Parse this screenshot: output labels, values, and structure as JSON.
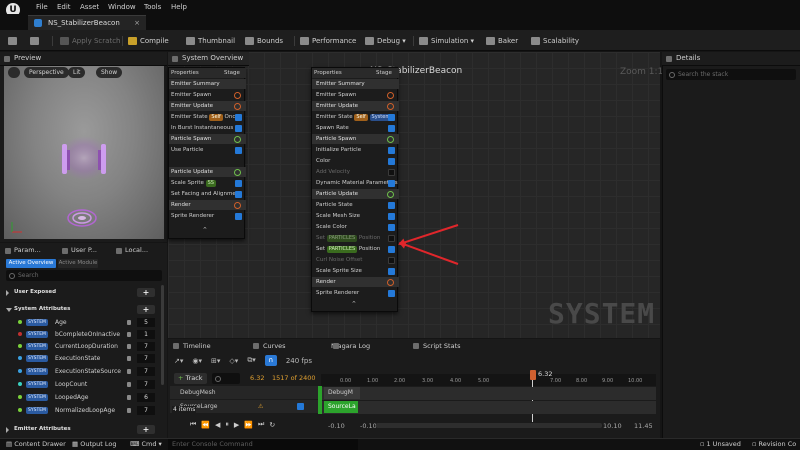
{
  "menu": {
    "items": [
      "File",
      "Edit",
      "Asset",
      "Window",
      "Tools",
      "Help"
    ]
  },
  "document_tab": {
    "label": "NS_StabilizerBeacon"
  },
  "toolbar": {
    "apply_scratch": "Apply Scratch",
    "compile": "Compile",
    "thumbnail": "Thumbnail",
    "bounds": "Bounds",
    "performance": "Performance",
    "debug": "Debug",
    "simulation": "Simulation",
    "baker": "Baker",
    "scalability": "Scalability"
  },
  "preview": {
    "title": "Preview",
    "buttons": [
      "Perspective",
      "Lit",
      "Show"
    ]
  },
  "system_overview": {
    "title": "System Overview",
    "graph_title": "NS_StabilizerBeacon",
    "zoom": "Zoom 1:1",
    "watermark": "SYSTEM",
    "left_node": {
      "header_a": "Properties",
      "header_b": "Stage",
      "rows": [
        "Emitter Summary",
        "Emitter Spawn",
        "Emitter Update",
        "Emitter State",
        "In Burst Instantaneous",
        "Particle Spawn",
        "Use Particle",
        "Particle Update",
        "Scale Sprite",
        "Set Facing and Alignment",
        "Render",
        "Sprite Renderer"
      ],
      "state_pill": "Self",
      "state_once": "Once",
      "spawn_pill": "SS"
    },
    "emitter_node": {
      "header_a": "Properties",
      "header_b": "Stage",
      "rows": [
        "Emitter Summary",
        "Emitter Spawn",
        "Emitter Update",
        "Emitter State",
        "Spawn Rate",
        "Particle Spawn",
        "Initialize Particle",
        "Color",
        "Add Velocity",
        "Dynamic Material Parameters",
        "Particle Update",
        "Particle State",
        "Scale Mesh Size",
        "Scale Color",
        "Set",
        "Set",
        "Curl Noise Offset",
        "Scale Sprite Size",
        "Render",
        "Sprite Renderer"
      ],
      "state_pill": "Self",
      "state_sys": "System",
      "particles_pill": "PARTICLES",
      "position_label": "Position"
    }
  },
  "details": {
    "title": "Details",
    "search_placeholder": "Search the stack"
  },
  "params": {
    "tabs": [
      "Param...",
      "User P...",
      "Local..."
    ],
    "segments": [
      "Active Overview",
      "Active Module"
    ],
    "search_placeholder": "Search",
    "categories": [
      "User Exposed",
      "System Attributes",
      "Emitter Attributes"
    ],
    "badge": "SYSTEM",
    "rows": [
      {
        "name": "Age",
        "count": "5",
        "color": "#7ad13b"
      },
      {
        "name": "bCompleteOnInactive",
        "count": "1",
        "color": "#c03030"
      },
      {
        "name": "CurrentLoopDuration",
        "count": "7",
        "color": "#7ad13b"
      },
      {
        "name": "ExecutionState",
        "count": "7",
        "color": "#3aa0e0"
      },
      {
        "name": "ExecutionStateSource",
        "count": "7",
        "color": "#3aa0e0"
      },
      {
        "name": "LoopCount",
        "count": "7",
        "color": "#3ad0c0"
      },
      {
        "name": "LoopedAge",
        "count": "6",
        "color": "#7ad13b"
      },
      {
        "name": "NormalizedLoopAge",
        "count": "7",
        "color": "#7ad13b"
      }
    ]
  },
  "timeline": {
    "tabs": [
      "Timeline",
      "Curves",
      "Niagara Log",
      "Script Stats"
    ],
    "fps": "240 fps",
    "add_track": "Track",
    "time": "6.32",
    "frame": "1517 of 2400",
    "playhead": "6.32",
    "ticks": [
      "0.00",
      "1.00",
      "2.00",
      "3.00",
      "4.00",
      "5.00",
      "7.00",
      "8.00",
      "9.00",
      "10.00",
      "11.00"
    ],
    "tracks": [
      "DebugMesh",
      "SourceLarge"
    ],
    "clips": [
      "DebugM",
      "SourceLa"
    ],
    "items_count": "4 items",
    "range_start": "-0.10",
    "range_start2": "-0.10",
    "range_end": "10.10",
    "range_end2": "11.45"
  },
  "status": {
    "content_drawer": "Content Drawer",
    "output_log": "Output Log",
    "cmd": "Cmd",
    "console_placeholder": "Enter Console Command",
    "unsaved": "1 Unsaved",
    "revision": "Revision Co"
  }
}
